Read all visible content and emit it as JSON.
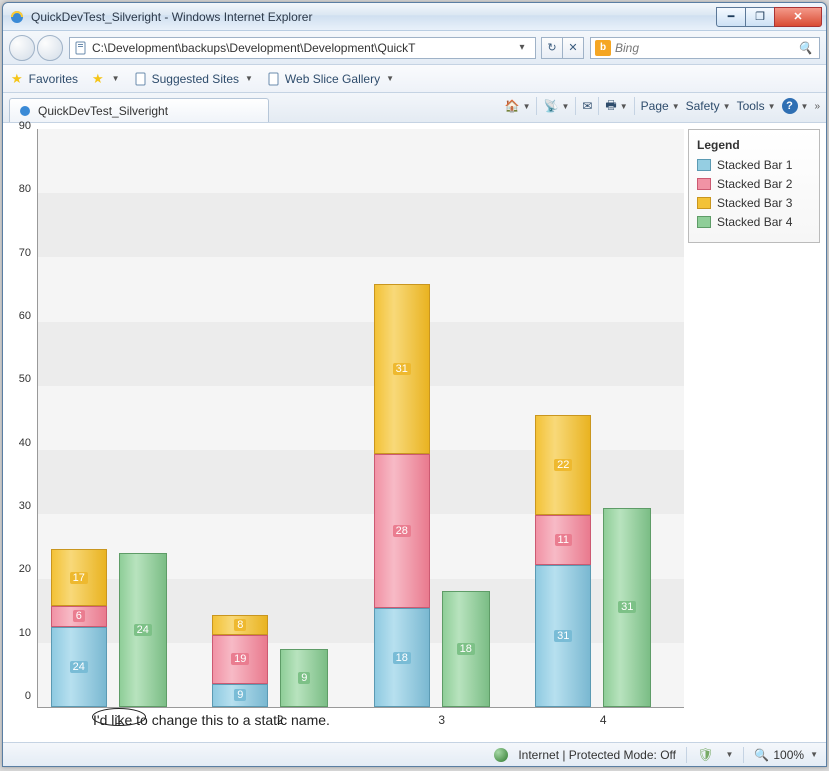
{
  "window": {
    "title": "QuickDevTest_Silveright - Windows Internet Explorer"
  },
  "nav": {
    "address": "C:\\Development\\backups\\Development\\Development\\QuickT",
    "search_placeholder": "Bing"
  },
  "favorites": {
    "label": "Favorites",
    "suggested": "Suggested Sites",
    "webslice": "Web Slice Gallery"
  },
  "tab": {
    "title": "QuickDevTest_Silveright"
  },
  "commands": {
    "page": "Page",
    "safety": "Safety",
    "tools": "Tools"
  },
  "chart_data": {
    "type": "bar",
    "categories": [
      "1",
      "2",
      "3",
      "4"
    ],
    "ylim": [
      0,
      90
    ],
    "y_ticks": [
      0,
      10,
      20,
      30,
      40,
      50,
      60,
      70,
      80,
      90
    ],
    "series": [
      {
        "name": "Stacked Bar 1",
        "role": "stack",
        "values": [
          24,
          9,
          18,
          31
        ]
      },
      {
        "name": "Stacked Bar 2",
        "role": "stack",
        "values": [
          6,
          19,
          28,
          11
        ]
      },
      {
        "name": "Stacked Bar 3",
        "role": "stack",
        "values": [
          17,
          8,
          31,
          22
        ]
      },
      {
        "name": "Stacked Bar 4",
        "role": "side",
        "values": [
          24,
          9,
          18,
          31
        ]
      }
    ],
    "legend_title": "Legend",
    "legend_items": [
      "Stacked Bar 1",
      "Stacked Bar 2",
      "Stacked Bar 3",
      "Stacked Bar 4"
    ]
  },
  "annotation": "I'd like to change this to a static name.",
  "status": {
    "zone": "Internet | Protected Mode: Off",
    "zoom": "100%"
  }
}
